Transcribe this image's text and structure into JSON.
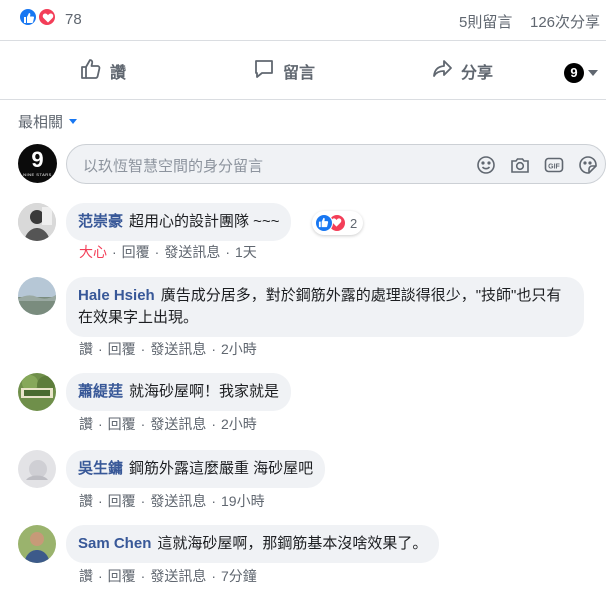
{
  "summary": {
    "reaction_count": "78",
    "comments_count": "5則留言",
    "shares_count": "126次分享",
    "reaction_icons": [
      "like-icon",
      "love-icon"
    ],
    "colors": {
      "like": "#1877f2",
      "love": "#f33e58"
    }
  },
  "actions": {
    "like_label": "讚",
    "comment_label": "留言",
    "share_label": "分享",
    "page_logo_glyph": "9"
  },
  "sort": {
    "label": "最相關"
  },
  "composer": {
    "avatar_glyph": "9",
    "avatar_small_text": "NINE STARS",
    "placeholder": "以玖恆智慧空間的身分留言",
    "icons": [
      "emoji-icon",
      "camera-icon",
      "gif-icon",
      "sticker-icon"
    ]
  },
  "comments": [
    {
      "author": "范崇豪",
      "text": "超用心的設計團隊 ~~~",
      "reaction_count": "2",
      "reacted_label": "大心",
      "reply_label": "回覆",
      "message_label": "發送訊息",
      "time": "1天"
    },
    {
      "author": "Hale Hsieh",
      "text": "廣告成分居多，對於鋼筋外露的處理談得很少，\"技師\"也只有在效果字上出現。",
      "like_label": "讚",
      "reply_label": "回覆",
      "message_label": "發送訊息",
      "time": "2小時"
    },
    {
      "author": "蕭緹莛",
      "text": "就海砂屋啊！我家就是",
      "like_label": "讚",
      "reply_label": "回覆",
      "message_label": "發送訊息",
      "time": "2小時"
    },
    {
      "author": "吳生鏞",
      "text": "鋼筋外露這麼嚴重 海砂屋吧",
      "like_label": "讚",
      "reply_label": "回覆",
      "message_label": "發送訊息",
      "time": "19小時"
    },
    {
      "author": "Sam Chen",
      "text": "這就海砂屋啊，那鋼筋基本沒啥效果了。",
      "like_label": "讚",
      "reply_label": "回覆",
      "message_label": "發送訊息",
      "time": "7分鐘"
    }
  ]
}
